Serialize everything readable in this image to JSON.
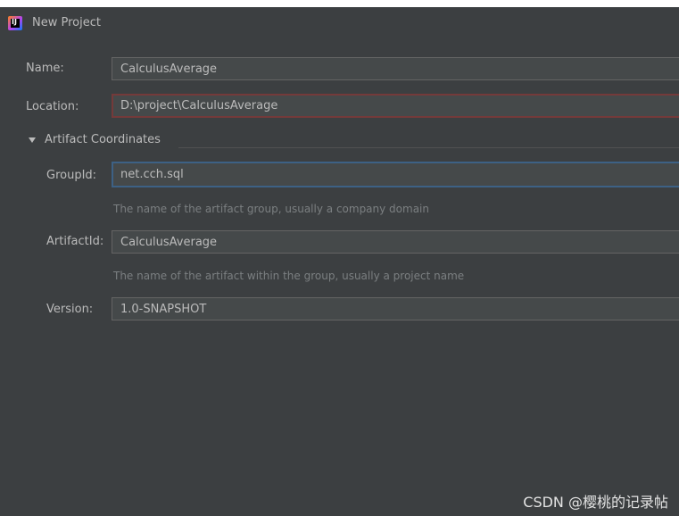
{
  "window": {
    "title": "New Project",
    "icon": "intellij-idea-icon"
  },
  "form": {
    "name": {
      "label": "Name:",
      "value": "CalculusAverage"
    },
    "location": {
      "label": "Location:",
      "value": "D:\\project\\CalculusAverage"
    },
    "artifact_coordinates": {
      "title": "Artifact Coordinates",
      "expanded": true,
      "group_id": {
        "label": "GroupId:",
        "value": "net.cch.sql",
        "hint": "The name of the artifact group, usually a company domain"
      },
      "artifact_id": {
        "label": "ArtifactId:",
        "value": "CalculusAverage",
        "hint": "The name of the artifact within the group, usually a project name"
      },
      "version": {
        "label": "Version:",
        "value": "1.0-SNAPSHOT"
      }
    }
  },
  "watermark": "CSDN @樱桃的记录帖",
  "colors": {
    "background": "#3c3f41",
    "field_background": "#45494a",
    "text": "#bbbbbb",
    "hint_text": "#7b7f81",
    "error_border": "#743a3a",
    "focus_border": "#3d6185"
  }
}
